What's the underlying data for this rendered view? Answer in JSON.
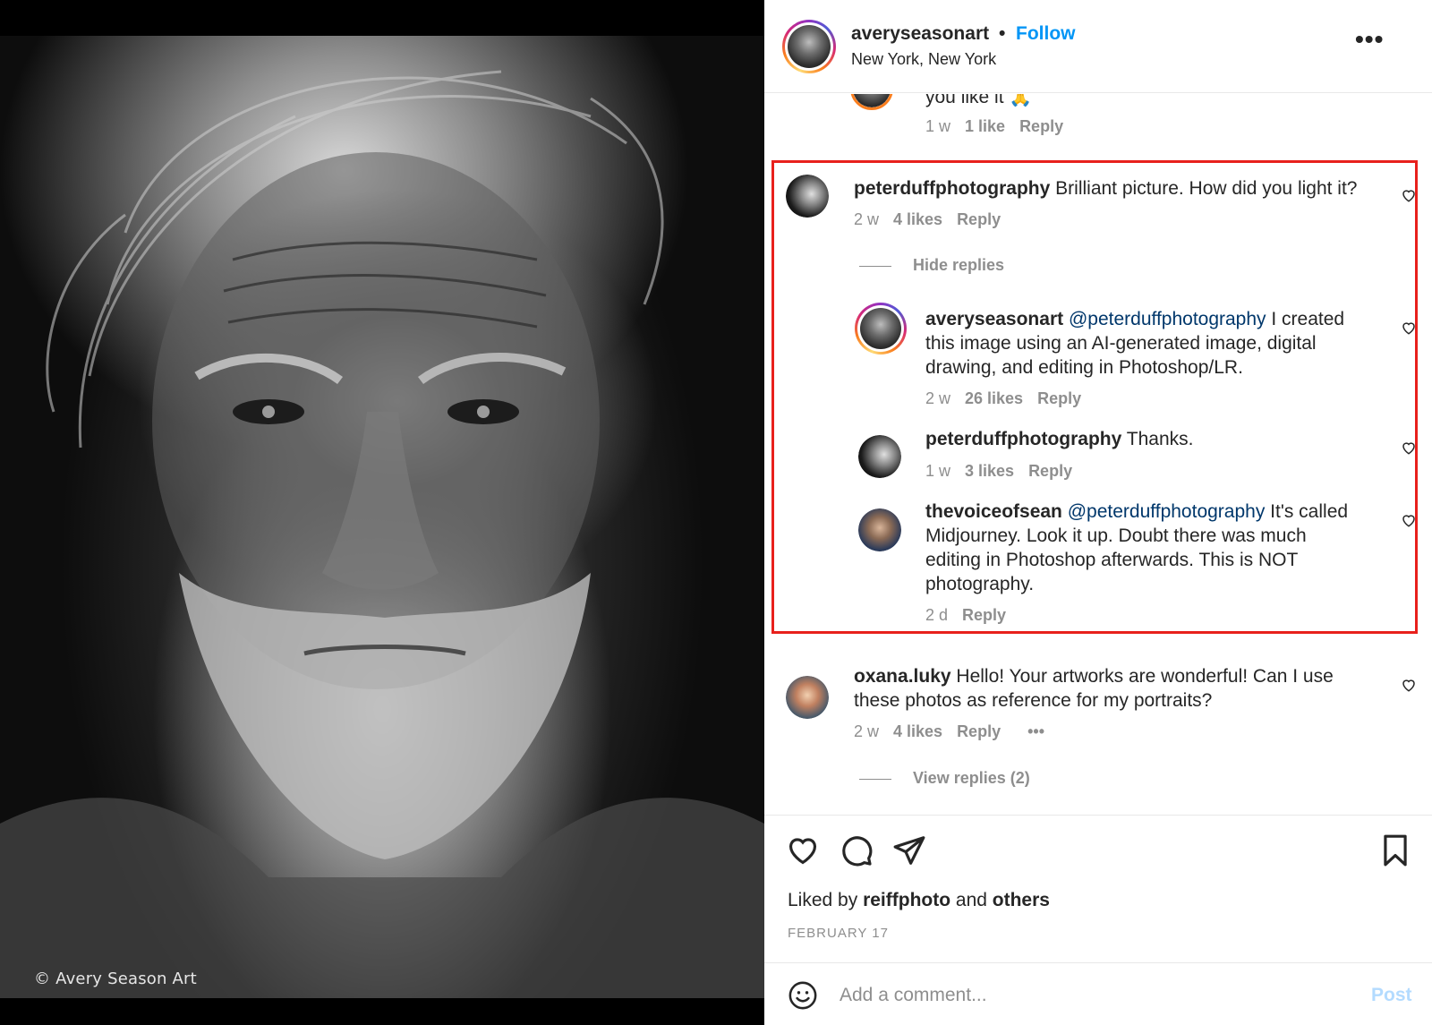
{
  "photo": {
    "credit": "© Avery Season Art"
  },
  "header": {
    "username": "averyseasonart",
    "separator": "•",
    "follow_label": "Follow",
    "location": "New York, New York",
    "more_icon": "more-horizontal-icon"
  },
  "comments": {
    "partial": {
      "text": "you like it 🙏",
      "time": "1 w",
      "likes": "1 like",
      "reply_label": "Reply"
    },
    "thread": {
      "user": "peterduffphotography",
      "text": "Brilliant picture. How did you light it?",
      "time": "2 w",
      "likes": "4 likes",
      "reply_label": "Reply",
      "hide_replies_label": "Hide replies",
      "replies": [
        {
          "user": "averyseasonart",
          "mention": "@peterduffphotography",
          "line1": "I created",
          "line2": "this image using an AI-generated image, digital",
          "line3": "drawing, and editing in Photoshop/LR.",
          "time": "2 w",
          "likes": "26 likes",
          "reply_label": "Reply"
        },
        {
          "user": "peterduffphotography",
          "text": "Thanks.",
          "time": "1 w",
          "likes": "3 likes",
          "reply_label": "Reply"
        },
        {
          "user": "thevoiceofsean",
          "mention": "@peterduffphotography",
          "line1": "It's called",
          "line2": "Midjourney. Look it up. Doubt there was much",
          "line3": "editing in Photoshop afterwards. This is NOT",
          "line4": "photography.",
          "time": "2 d",
          "reply_label": "Reply"
        }
      ]
    },
    "next": {
      "user": "oxana.luky",
      "line1": "Hello! Your artworks are wonderful! Can I use",
      "line2": "these photos as reference for my portraits?",
      "time": "2 w",
      "likes": "4 likes",
      "reply_label": "Reply",
      "more_label": "•••",
      "view_replies_label": "View replies (2)"
    }
  },
  "actions": {
    "liked_by_prefix": "Liked by",
    "liked_by_user": "reiffphoto",
    "liked_by_and": "and",
    "liked_by_others": "others",
    "date": "FEBRUARY 17",
    "comment_placeholder": "Add a comment...",
    "post_label": "Post"
  },
  "colors": {
    "follow": "#0095f6",
    "mention": "#00376b",
    "highlight": "#e8201c",
    "muted": "#8e8e8e",
    "post_disabled": "#b3dbff"
  }
}
